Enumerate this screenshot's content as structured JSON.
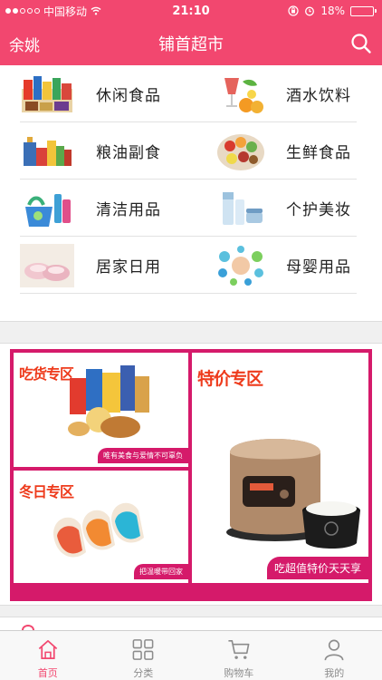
{
  "status_bar": {
    "carrier": "中国移动",
    "time": "21:10",
    "battery": "18%",
    "battery_level": 0.18
  },
  "header": {
    "city": "余姚",
    "title": "铺首超市"
  },
  "categories": [
    {
      "label": "休闲食品",
      "icon": "snacks-icon"
    },
    {
      "label": "酒水饮料",
      "icon": "drinks-icon"
    },
    {
      "label": "粮油副食",
      "icon": "grain-oil-icon"
    },
    {
      "label": "生鲜食品",
      "icon": "fresh-food-icon"
    },
    {
      "label": "清洁用品",
      "icon": "cleaning-icon"
    },
    {
      "label": "个护美妆",
      "icon": "cosmetics-icon"
    },
    {
      "label": "居家日用",
      "icon": "home-goods-icon"
    },
    {
      "label": "母婴用品",
      "icon": "baby-products-icon"
    }
  ],
  "promo": {
    "snack_zone": {
      "title": "吃货专区",
      "tagline": "唯有美食与爱情不可辜负"
    },
    "winter_zone": {
      "title": "冬日专区",
      "tagline": "把温暖带回家"
    },
    "sale_zone": {
      "title": "特价专区",
      "tagline": "吃超值特价天天享"
    },
    "accent_color": "#d51a6a"
  },
  "tabs": [
    {
      "label": "首页",
      "icon": "home-icon",
      "active": true
    },
    {
      "label": "分类",
      "icon": "grid-icon",
      "active": false
    },
    {
      "label": "购物车",
      "icon": "cart-icon",
      "active": false
    },
    {
      "label": "我的",
      "icon": "user-icon",
      "active": false
    }
  ],
  "theme": {
    "brand": "#f2476f",
    "tab_inactive": "#8c8c8c"
  }
}
